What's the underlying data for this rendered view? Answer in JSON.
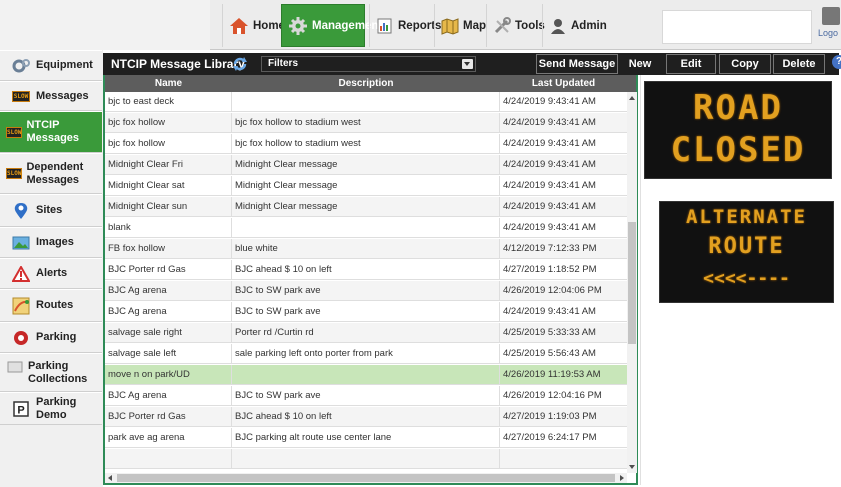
{
  "nav": {
    "items": [
      {
        "label": "Home",
        "icon": "home-icon"
      },
      {
        "label": "Management",
        "icon": "gear-icon",
        "active": true
      },
      {
        "label": "Reports",
        "icon": "reports-icon"
      },
      {
        "label": "Map",
        "icon": "map-icon"
      },
      {
        "label": "Tools",
        "icon": "tools-icon"
      },
      {
        "label": "Admin",
        "icon": "admin-icon"
      }
    ],
    "logo_text": "Logo"
  },
  "sidebar": {
    "items": [
      {
        "label": "Equipment",
        "icon": "equipment-icon"
      },
      {
        "label": "Messages",
        "icon": "sign-icon"
      },
      {
        "label": "NTCIP Messages",
        "icon": "sign-icon",
        "active": true
      },
      {
        "label": "Dependent Messages",
        "icon": "sign-icon"
      },
      {
        "label": "Sites",
        "icon": "location-pin-icon"
      },
      {
        "label": "Images",
        "icon": "image-icon"
      },
      {
        "label": "Alerts",
        "icon": "alert-triangle-icon"
      },
      {
        "label": "Routes",
        "icon": "routes-icon"
      },
      {
        "label": "Parking",
        "icon": "parking-circle-icon"
      },
      {
        "label": "Parking Collections",
        "icon": "parking-collections-icon"
      },
      {
        "label": "Parking Demo",
        "icon": "parking-p-icon"
      }
    ],
    "sign_icon_text": "SLOW"
  },
  "toolbar": {
    "title": "NTCIP Message Library",
    "filters_label": "Filters",
    "send_label": "Send Message",
    "new_label": "New",
    "edit_label": "Edit",
    "copy_label": "Copy",
    "delete_label": "Delete",
    "help_label": "?"
  },
  "table": {
    "columns": [
      "Name",
      "Description",
      "Last Updated"
    ],
    "rows": [
      {
        "name": "bjc to east deck",
        "description": "",
        "updated": "4/24/2019 9:43:41 AM"
      },
      {
        "name": "bjc fox hollow",
        "description": "bjc fox hollow to stadium west",
        "updated": "4/24/2019 9:43:41 AM"
      },
      {
        "name": "bjc fox hollow",
        "description": "bjc fox hollow to stadium west",
        "updated": "4/24/2019 9:43:41 AM"
      },
      {
        "name": "Midnight Clear Fri",
        "description": "Midnight Clear message",
        "updated": "4/24/2019 9:43:41 AM"
      },
      {
        "name": "Midnight Clear sat",
        "description": "Midnight Clear message",
        "updated": "4/24/2019 9:43:41 AM"
      },
      {
        "name": "Midnight Clear sun",
        "description": "Midnight Clear message",
        "updated": "4/24/2019 9:43:41 AM"
      },
      {
        "name": "blank",
        "description": "",
        "updated": "4/24/2019 9:43:41 AM"
      },
      {
        "name": "FB fox hollow",
        "description": "blue white",
        "updated": "4/12/2019 7:12:33 PM"
      },
      {
        "name": "BJC Porter rd Gas",
        "description": "BJC ahead $ 10 on left",
        "updated": "4/27/2019 1:18:52 PM"
      },
      {
        "name": "BJC Ag arena",
        "description": "BJC to SW park ave",
        "updated": "4/26/2019 12:04:06 PM"
      },
      {
        "name": "BJC Ag arena",
        "description": "BJC to SW park ave",
        "updated": "4/24/2019 9:43:41 AM"
      },
      {
        "name": "salvage sale right",
        "description": "Porter rd /Curtin rd",
        "updated": "4/25/2019 5:33:33 AM"
      },
      {
        "name": "salvage sale left",
        "description": "sale parking left onto porter from park",
        "updated": "4/25/2019 5:56:43 AM"
      },
      {
        "name": "move n on park/UD",
        "description": "",
        "updated": "4/26/2019 11:19:53 AM",
        "selected": true
      },
      {
        "name": "BJC Ag arena",
        "description": "BJC to SW park ave",
        "updated": "4/26/2019 12:04:16 PM"
      },
      {
        "name": "BJC Porter rd Gas",
        "description": "BJC ahead $ 10 on left",
        "updated": "4/27/2019 1:19:03 PM"
      },
      {
        "name": "park ave ag arena",
        "description": "BJC parking alt route use center lane",
        "updated": "4/27/2019 6:24:17 PM"
      },
      {
        "name": "",
        "description": "",
        "updated": ""
      }
    ]
  },
  "preview": {
    "sign1": [
      "ROAD",
      "CLOSED"
    ],
    "sign2": [
      "ALTERNATE",
      "ROUTE",
      "<<<<----"
    ]
  },
  "colors": {
    "accent_green": "#3a9a3a",
    "selected_row": "#c8e6b9",
    "led_amber": "#e2a020"
  }
}
